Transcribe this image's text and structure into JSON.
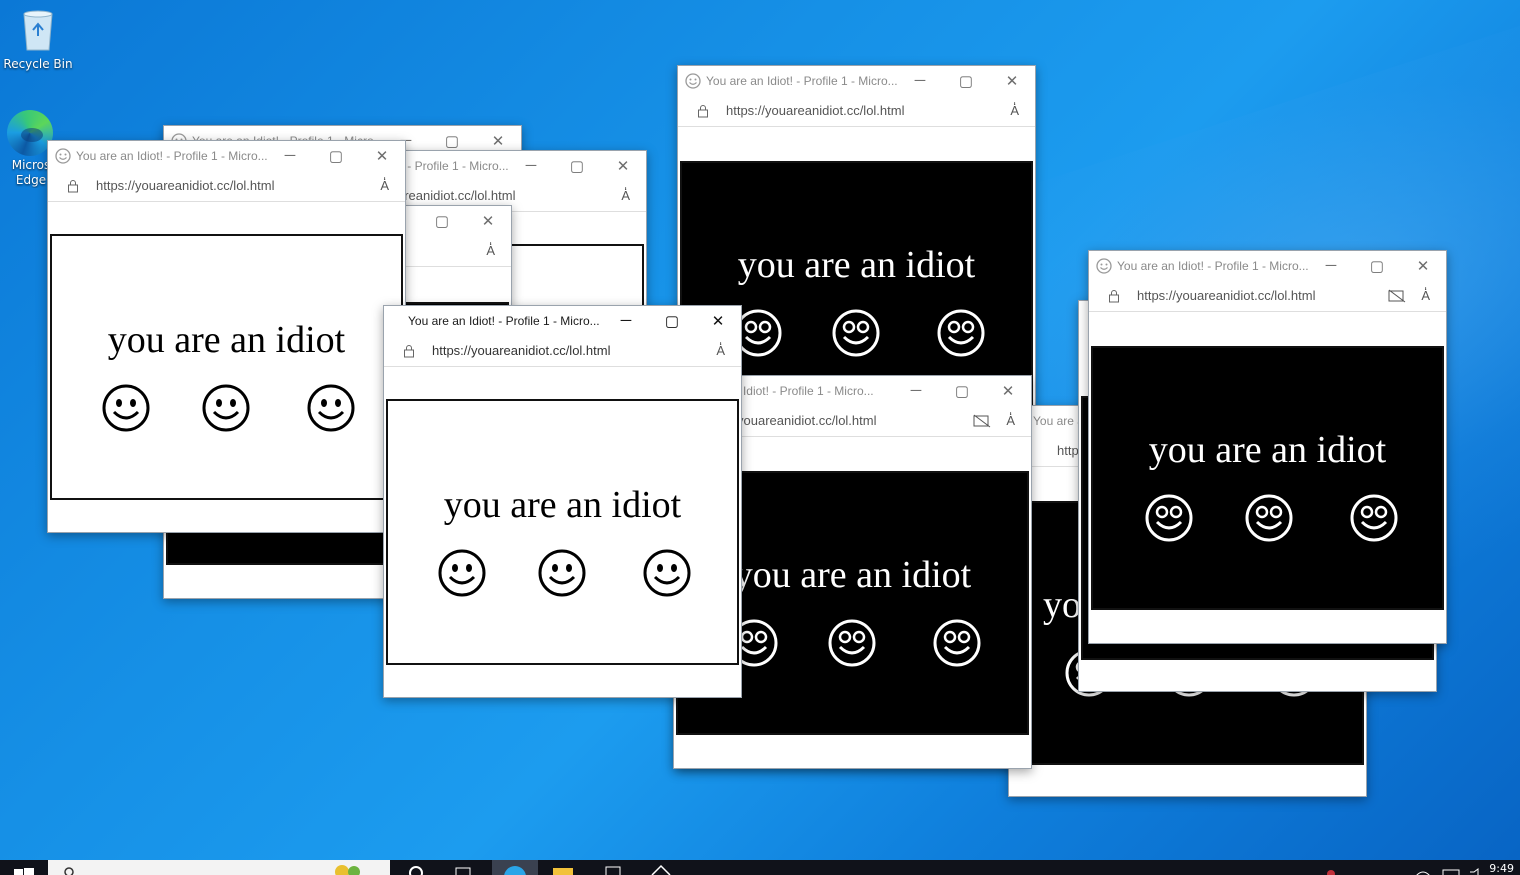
{
  "desktop": {
    "icons": [
      {
        "label": "Recycle Bin"
      },
      {
        "label": "Micros Edge"
      }
    ]
  },
  "window": {
    "title": "You are an Idiot! - Profile 1 - Micro...",
    "url": "https://youareanidiot.cc/lol.html",
    "read_aloud": "A̒",
    "page_text": "you are an idiot"
  },
  "taskbar": {
    "clock": "9:49"
  },
  "colors": {
    "desktop_blue": "#1690e6",
    "taskbar": "#10121a",
    "popup_black": "#000000",
    "popup_white": "#ffffff"
  }
}
